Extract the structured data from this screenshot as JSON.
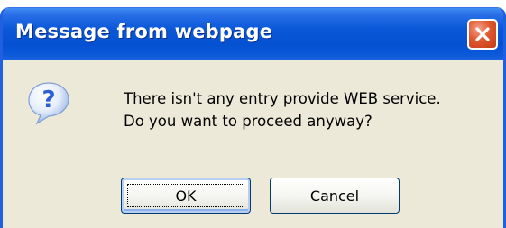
{
  "dialog": {
    "title": "Message from webpage",
    "close_icon": "close-icon",
    "message_lines": [
      "There isn't any entry provide WEB service.",
      "Do you want to proceed anyway?"
    ],
    "icon": "question-icon",
    "buttons": {
      "ok_label": "OK",
      "cancel_label": "Cancel"
    }
  },
  "colors": {
    "titlebar": "#0451d2",
    "body": "#ece9d8",
    "close_button": "#e0582f",
    "question_icon": "#2b5fd8"
  }
}
